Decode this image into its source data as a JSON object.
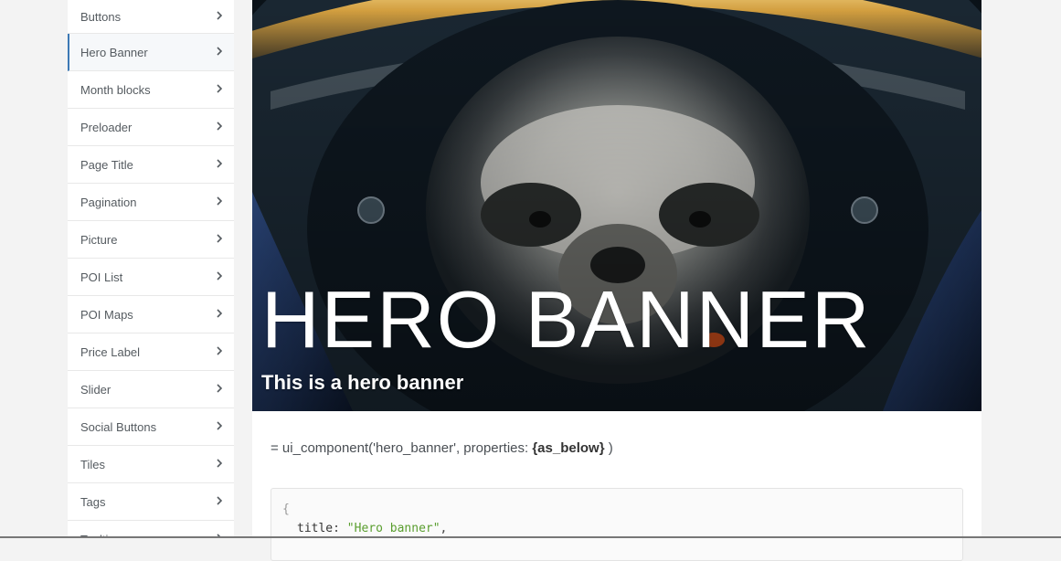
{
  "sidebar": {
    "items": [
      {
        "label": "Buttons",
        "active": false
      },
      {
        "label": "Hero Banner",
        "active": true
      },
      {
        "label": "Month blocks",
        "active": false
      },
      {
        "label": "Preloader",
        "active": false
      },
      {
        "label": "Page Title",
        "active": false
      },
      {
        "label": "Pagination",
        "active": false
      },
      {
        "label": "Picture",
        "active": false
      },
      {
        "label": "POI List",
        "active": false
      },
      {
        "label": "POI Maps",
        "active": false
      },
      {
        "label": "Price Label",
        "active": false
      },
      {
        "label": "Slider",
        "active": false
      },
      {
        "label": "Social Buttons",
        "active": false
      },
      {
        "label": "Tiles",
        "active": false
      },
      {
        "label": "Tags",
        "active": false
      },
      {
        "label": "Tooltips",
        "active": false
      }
    ],
    "chevron_icon": "chevron-right-icon"
  },
  "hero": {
    "title": "HERO BANNER",
    "subtitle": "This is a hero banner",
    "image": "sloth-astronaut-helmet"
  },
  "usage": {
    "prefix": "= ui_component('hero_banner', properties: ",
    "highlight": "{as_below}",
    "suffix": " )"
  },
  "code": {
    "open_brace": "{",
    "key": "title",
    "colon": ": ",
    "value": "\"Hero banner\"",
    "comma": ","
  },
  "colors": {
    "accent": "#3c79b5",
    "string": "#5a9e2f",
    "text": "#555b60"
  }
}
